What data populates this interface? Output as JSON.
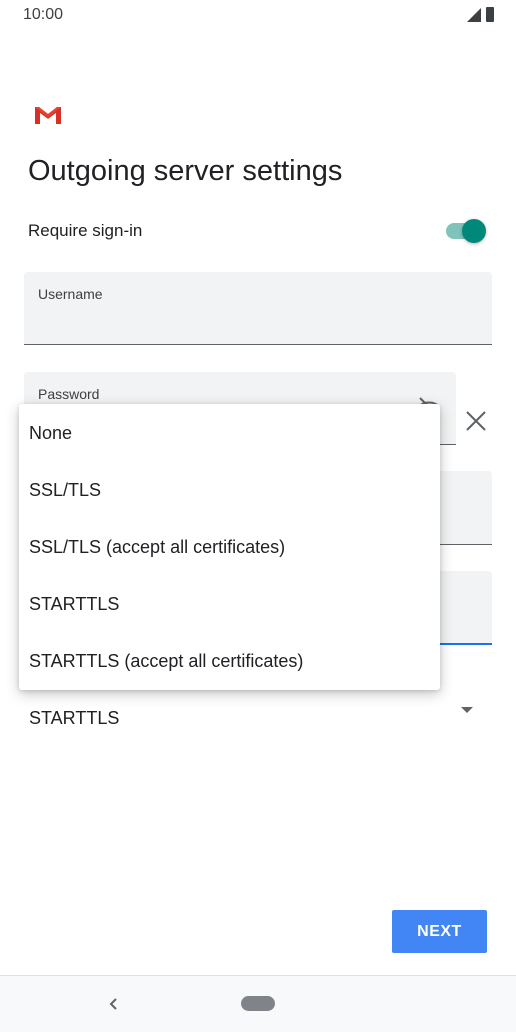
{
  "status_bar": {
    "time": "10:00",
    "icons": [
      "signal-icon",
      "battery-icon"
    ]
  },
  "header": {
    "logo": "gmail-logo",
    "title": "Outgoing server settings"
  },
  "require_signin": {
    "label": "Require sign-in",
    "enabled": true
  },
  "fields": {
    "username": {
      "label": "Username",
      "value": ""
    },
    "password": {
      "label": "Password",
      "value": ""
    }
  },
  "security": {
    "selected": "STARTTLS",
    "options": [
      "None",
      "SSL/TLS",
      "SSL/TLS (accept all certificates)",
      "STARTTLS",
      "STARTTLS (accept all certificates)"
    ]
  },
  "actions": {
    "next_label": "NEXT"
  },
  "colors": {
    "accent": "#4285f4",
    "toggle": "#00897b",
    "field_bg": "#f1f3f4"
  },
  "nav": {
    "icons": [
      "back-icon",
      "home-icon"
    ]
  }
}
